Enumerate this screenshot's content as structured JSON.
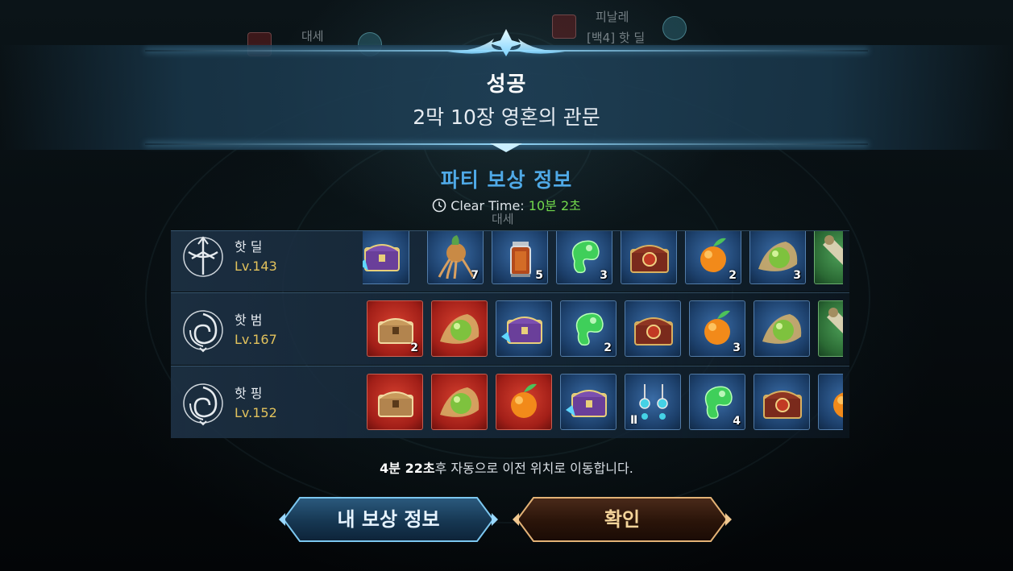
{
  "background": {
    "player_name_left": "대세",
    "player_name_right": "피날레",
    "player_guild_right": "[백4] 핫 딜",
    "player_name_center": "대세"
  },
  "result": {
    "title": "성공",
    "stage_name": "2막 10장 영혼의 관문"
  },
  "party_reward": {
    "heading": "파티 보상 정보",
    "clear_time_label": "Clear Time:",
    "clear_time_value": "10분 2초",
    "members": [
      {
        "name": "핫 딜",
        "level": "Lv.143",
        "class_icon": "crossbow-class-icon",
        "items": [
          {
            "icon": "purple-chest-icon",
            "frame": "blue",
            "count": ""
          },
          {
            "icon": "ginseng-root-icon",
            "frame": "blue",
            "count": "7"
          },
          {
            "icon": "lantern-potion-icon",
            "frame": "blue",
            "count": "5"
          },
          {
            "icon": "green-jade-icon",
            "frame": "blue",
            "count": "3"
          },
          {
            "icon": "ornate-chest-icon",
            "frame": "blue",
            "count": ""
          },
          {
            "icon": "golden-fruit-icon",
            "frame": "blue",
            "count": "2"
          },
          {
            "icon": "green-orb-icon",
            "frame": "blue",
            "count": "3"
          },
          {
            "icon": "scroll-icon",
            "frame": "green",
            "count": ""
          }
        ]
      },
      {
        "name": "핫 범",
        "level": "Lv.167",
        "class_icon": "spiral-class-icon",
        "items": [
          {
            "icon": "red-chest-icon",
            "frame": "red",
            "count": "2"
          },
          {
            "icon": "green-orb-icon",
            "frame": "red",
            "count": ""
          },
          {
            "icon": "purple-chest-icon",
            "frame": "blue",
            "count": ""
          },
          {
            "icon": "green-jade-icon",
            "frame": "blue",
            "count": "2"
          },
          {
            "icon": "ornate-chest-icon",
            "frame": "blue",
            "count": ""
          },
          {
            "icon": "golden-fruit-icon",
            "frame": "blue",
            "count": "3"
          },
          {
            "icon": "green-orb-icon",
            "frame": "blue",
            "count": ""
          },
          {
            "icon": "scroll-icon",
            "frame": "green",
            "count": ""
          }
        ]
      },
      {
        "name": "핫 핑",
        "level": "Lv.152",
        "class_icon": "spiral-class-icon",
        "items": [
          {
            "icon": "red-chest-icon",
            "frame": "red",
            "count": ""
          },
          {
            "icon": "green-orb-icon",
            "frame": "red",
            "count": ""
          },
          {
            "icon": "golden-fruit-icon",
            "frame": "red",
            "count": ""
          },
          {
            "icon": "purple-chest-icon",
            "frame": "blue",
            "count": ""
          },
          {
            "icon": "earring-icon",
            "frame": "blue",
            "count": "",
            "grade": "Ⅱ"
          },
          {
            "icon": "green-jade-icon",
            "frame": "blue",
            "count": "4"
          },
          {
            "icon": "ornate-chest-icon",
            "frame": "blue",
            "count": ""
          },
          {
            "icon": "golden-fruit-icon",
            "frame": "blue",
            "count": ""
          }
        ]
      }
    ]
  },
  "footer": {
    "auto_move_time": "4분 22초",
    "auto_move_text": "후 자동으로 이전 위치로 이동합니다.",
    "my_reward_button": "내 보상 정보",
    "confirm_button": "확인"
  },
  "colors": {
    "heading": "#4fa9e6",
    "clear_time_value": "#72d84c",
    "level": "#e2c25c",
    "confirm_label": "#f4d49a"
  }
}
